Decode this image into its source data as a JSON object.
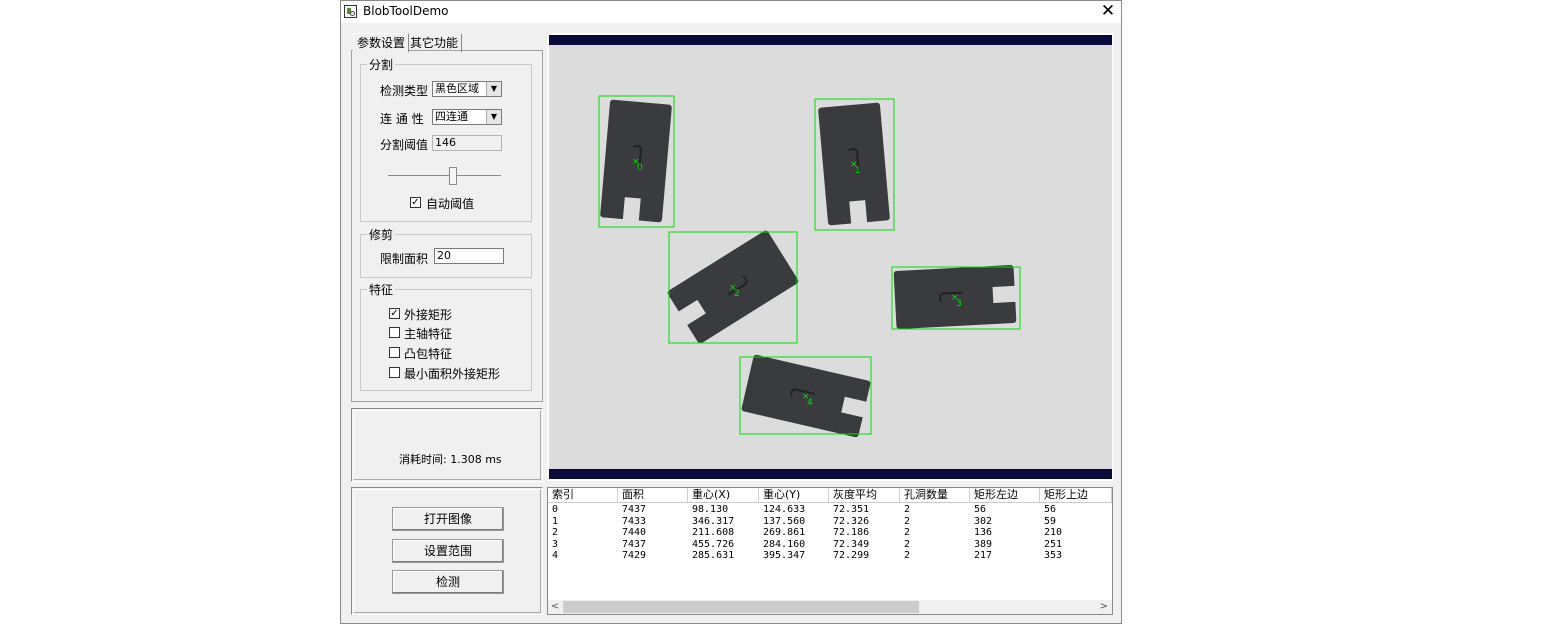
{
  "window": {
    "title": "BlobToolDemo",
    "close_glyph": "✕",
    "icon": "app-icon"
  },
  "tabs": [
    {
      "label": "参数设置",
      "active": true
    },
    {
      "label": "其它功能",
      "active": false
    }
  ],
  "segmentation": {
    "group_label": "分割",
    "detect_type_label": "检测类型",
    "detect_type_value": "黑色区域",
    "connectivity_label": "连 通 性",
    "connectivity_value": "四连通",
    "threshold_label": "分割阈值",
    "threshold_value": "146",
    "slider_value": 146,
    "slider_max": 255,
    "auto_threshold_label": "自动阈值",
    "auto_threshold_checked": true
  },
  "trim": {
    "group_label": "修剪",
    "area_limit_label": "限制面积",
    "area_limit_value": "20"
  },
  "features": {
    "group_label": "特征",
    "items": [
      {
        "label": "外接矩形",
        "checked": true
      },
      {
        "label": "主轴特征",
        "checked": false
      },
      {
        "label": "凸包特征",
        "checked": false
      },
      {
        "label": "最小面积外接矩形",
        "checked": false
      }
    ]
  },
  "time_label": "消耗时间: 1.308 ms",
  "buttons": {
    "open_image": "打开图像",
    "set_range": "设置范围",
    "detect": "检测"
  },
  "colors": {
    "accent_box": "#00e000",
    "viewer_bar": "#0a0a3c",
    "part": "#3a3b3e",
    "background": "#dcdcdc"
  },
  "blobs": [
    {
      "label": "0"
    },
    {
      "label": "1"
    },
    {
      "label": "2"
    },
    {
      "label": "3"
    },
    {
      "label": "4"
    }
  ],
  "table": {
    "columns": [
      "索引",
      "面积",
      "重心(X)",
      "重心(Y)",
      "灰度平均",
      "孔洞数量",
      "矩形左边",
      "矩形上边"
    ],
    "rows": [
      [
        "0",
        "7437",
        "98.130",
        "124.633",
        "72.351",
        "2",
        "56",
        "56"
      ],
      [
        "1",
        "7433",
        "346.317",
        "137.560",
        "72.326",
        "2",
        "302",
        "59"
      ],
      [
        "2",
        "7440",
        "211.608",
        "269.861",
        "72.186",
        "2",
        "136",
        "210"
      ],
      [
        "3",
        "7437",
        "455.726",
        "284.160",
        "72.349",
        "2",
        "389",
        "251"
      ],
      [
        "4",
        "7429",
        "285.631",
        "395.347",
        "72.299",
        "2",
        "217",
        "353"
      ]
    ],
    "scroll_left": "<",
    "scroll_right": ">"
  }
}
